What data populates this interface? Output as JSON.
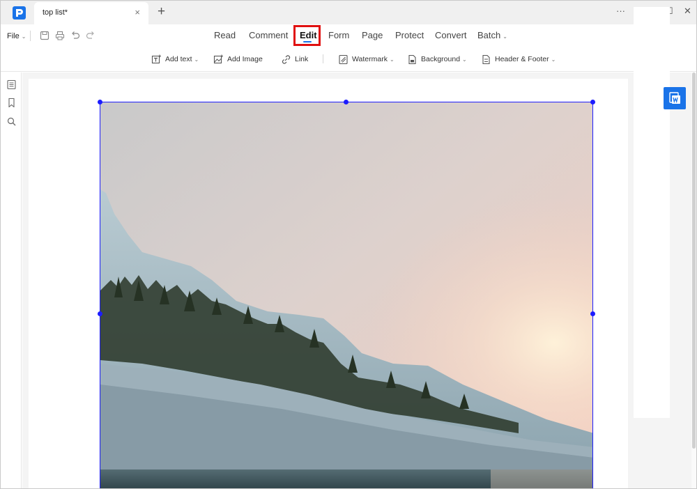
{
  "window": {
    "tab_title": "top list*",
    "tab_close_glyph": "×",
    "new_tab_glyph": "+",
    "more_glyph": "···",
    "minimize_glyph": "—",
    "maximize_glyph": "☐",
    "close_glyph": "✕"
  },
  "menu": {
    "file_label": "File",
    "items": [
      {
        "label": "Read"
      },
      {
        "label": "Comment"
      },
      {
        "label": "Edit",
        "active": true
      },
      {
        "label": "Form"
      },
      {
        "label": "Page"
      },
      {
        "label": "Protect"
      },
      {
        "label": "Convert"
      },
      {
        "label": "Batch"
      }
    ],
    "caret_glyph": "⌄",
    "quick_access": [
      "save-icon",
      "print-icon",
      "undo-icon",
      "redo-icon"
    ]
  },
  "toolbar": {
    "add_text": "Add text",
    "add_image": "Add Image",
    "link": "Link",
    "watermark": "Watermark",
    "background": "Background",
    "header_footer": "Header & Footer",
    "caret_glyph": "⌄"
  },
  "left_rail": [
    "thumbnails-icon",
    "bookmark-icon",
    "search-icon"
  ],
  "colors": {
    "accent": "#1a73e8",
    "selection": "#1c1cff",
    "active_highlight": "#e01010"
  }
}
